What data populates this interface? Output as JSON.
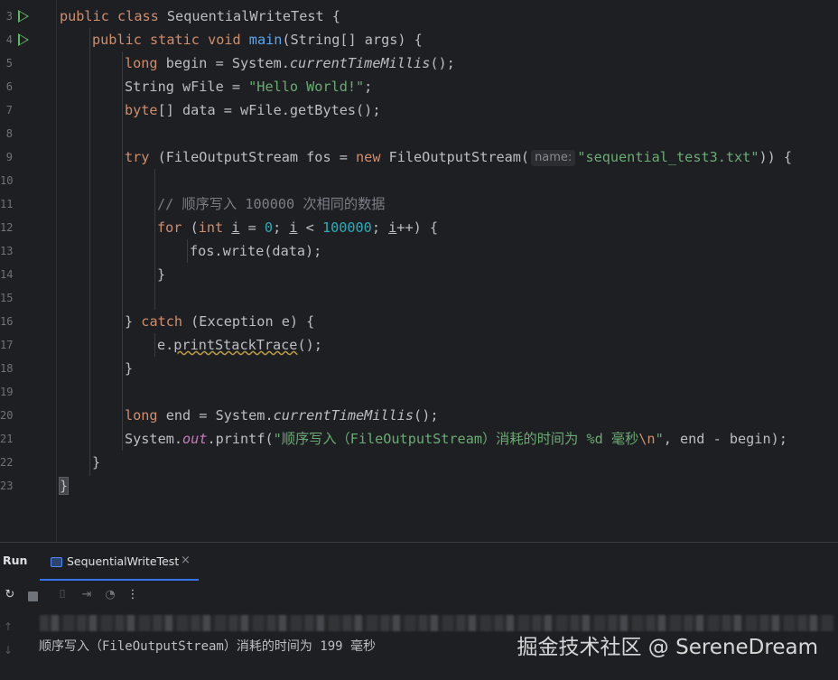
{
  "editor": {
    "line_numbers": [
      "3",
      "4",
      "5",
      "6",
      "7",
      "8",
      "9",
      "10",
      "11",
      "12",
      "13",
      "14",
      "15",
      "16",
      "17",
      "18",
      "19",
      "20",
      "21",
      "22",
      "23"
    ],
    "code": {
      "l3": {
        "kw1": "public",
        "kw2": "class",
        "name": "SequentialWriteTest",
        "rest": " {"
      },
      "l4": {
        "kw1": "public",
        "kw2": "static",
        "kw3": "void",
        "fn": "main",
        "rest": "(String[] args) {"
      },
      "l5": {
        "kw": "long",
        "a": " begin = System.",
        "method": "currentTimeMillis",
        "b": "();"
      },
      "l6": {
        "a": "String wFile = ",
        "str": "\"Hello World!\"",
        "b": ";"
      },
      "l7": {
        "kw": "byte",
        "a": "[] data = wFile.getBytes();"
      },
      "l9": {
        "kw1": "try",
        "a": " (FileOutputStream fos = ",
        "kw2": "new",
        "b": " FileOutputStream(",
        "hint": "name:",
        "str": "\"sequential_test3.txt\"",
        "c": ")) {"
      },
      "l11": {
        "comment": "// 顺序写入 100000 次相同的数据"
      },
      "l12": {
        "kw1": "for",
        "a": " (",
        "kw2": "int",
        "b": " ",
        "v1": "i",
        "c": " = ",
        "n1": "0",
        "d": "; ",
        "v2": "i",
        "e": " < ",
        "n2": "100000",
        "f": "; ",
        "v3": "i",
        "g": "++) {"
      },
      "l13": {
        "a": "fos.write(data);"
      },
      "l14": {
        "a": "}"
      },
      "l16": {
        "a": "} ",
        "kw": "catch",
        "b": " (Exception e) {"
      },
      "l17": {
        "a": "e.",
        "warn": "printStackTrace",
        "b": "();"
      },
      "l18": {
        "a": "}"
      },
      "l20": {
        "kw": "long",
        "a": " end = System.",
        "method": "currentTimeMillis",
        "b": "();"
      },
      "l21": {
        "a": "System.",
        "field": "out",
        "b": ".printf(",
        "str1": "\"顺序写入（FileOutputStream）消耗的时间为 %d 毫秒",
        "esc": "\\n",
        "str2": "\"",
        "c": ", end - begin);"
      },
      "l22": {
        "a": "}"
      },
      "l23": {
        "a": "}"
      }
    }
  },
  "run_panel": {
    "title": "Run",
    "tab_label": "SequentialWriteTest",
    "tab_close": "×",
    "toolbar": {
      "rerun": "↻",
      "screenshot": "⌷",
      "exit": "⇥",
      "gauge": "◔",
      "more": "⋮"
    },
    "gutter": {
      "up": "↑",
      "down": "↓"
    },
    "output": "顺序写入（FileOutputStream）消耗的时间为 199 毫秒"
  },
  "watermark": "掘金技术社区 @ SereneDream",
  "colors": {
    "keyword": "#cf8e6d",
    "function": "#56a8f5",
    "string": "#6aab73",
    "number": "#2aacb8",
    "comment": "#7a7e85",
    "field": "#c77dbb",
    "text": "#bcbec4",
    "background": "#1e1f22",
    "accent": "#3574f0"
  }
}
